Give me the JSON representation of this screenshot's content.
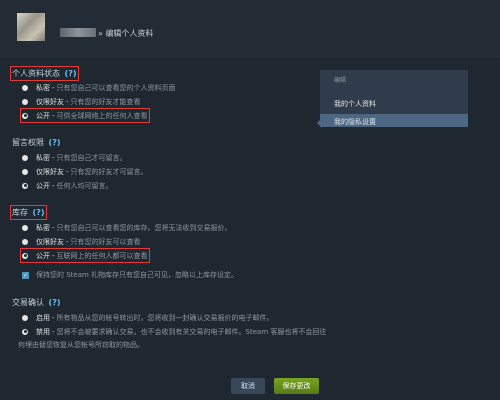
{
  "header": {
    "breadcrumb": "» 编辑个人资料"
  },
  "profile_status": {
    "title": "个人资料状态",
    "help": "(?)",
    "options": [
      {
        "label": "私密",
        "desc": "只有您自己可以查看您的个人资料页面"
      },
      {
        "label": "仅限好友",
        "desc": "只有您的好友才能查看"
      },
      {
        "label": "公开",
        "desc": "可供全球网络上的任何人查看"
      }
    ]
  },
  "comments": {
    "title": "留言权限",
    "help": "(?)",
    "options": [
      {
        "label": "私密",
        "desc": "只有您自己才可留言。"
      },
      {
        "label": "仅限好友",
        "desc": "只有您的好友才可留言。"
      },
      {
        "label": "公开",
        "desc": "任何人均可留言。"
      }
    ]
  },
  "inventory": {
    "title": "库存",
    "help": "(?)",
    "options": [
      {
        "label": "私密",
        "desc": "只有您自己可以查看您的库存。您将无法收到交易报价。"
      },
      {
        "label": "仅限好友",
        "desc": "只有您的好友可以查看"
      },
      {
        "label": "公开",
        "desc": "互联网上的任何人都可以查看"
      }
    ],
    "checkbox_text": "保持您的 Steam 礼物库存只有您自己可见，忽略以上库存设定。"
  },
  "trade_confirm": {
    "title": "交易确认",
    "help": "(?)",
    "options": [
      {
        "label": "启用",
        "desc": "所有物品从您的帐号转出时，您将收到一封确认交易报价的电子邮件。"
      },
      {
        "label": "禁用",
        "desc": "您将不会被要求确认交易，也不会收到有关交易的电子邮件。Steam 客服也将不会回往"
      }
    ],
    "wrap_line": "何埋由替您恢复从您帐号所窃取的物品。"
  },
  "sidebar": {
    "heading": "编辑",
    "items": [
      {
        "label": "我的个人资料"
      },
      {
        "label": "我的隐私设置"
      }
    ]
  },
  "buttons": {
    "cancel": "取消",
    "save": "保存更改"
  },
  "colors": {
    "background": "#1f2730",
    "accent": "#66c0f4",
    "highlight": "#e53935",
    "save": "#6a9a1f"
  }
}
